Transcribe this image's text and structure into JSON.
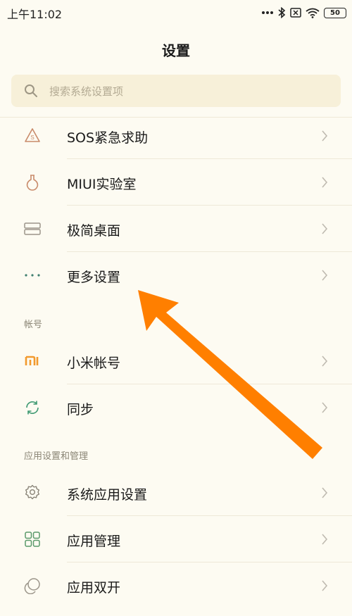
{
  "status_bar": {
    "time": "上午11:02",
    "battery": "50",
    "icons": [
      "dots-icon",
      "bluetooth-icon",
      "sim-off-icon",
      "wifi-icon",
      "battery-icon"
    ]
  },
  "page": {
    "title": "设置"
  },
  "search": {
    "placeholder": "搜索系统设置项"
  },
  "groups": [
    {
      "header": "",
      "items": [
        {
          "label": "SOS紧急求助",
          "icon": "sos-icon"
        },
        {
          "label": "MIUI实验室",
          "icon": "lab-flask-icon"
        },
        {
          "label": "极简桌面",
          "icon": "minimal-desktop-icon"
        },
        {
          "label": "更多设置",
          "icon": "more-dots-icon"
        }
      ]
    },
    {
      "header": "帐号",
      "items": [
        {
          "label": "小米帐号",
          "icon": "mi-logo-icon"
        },
        {
          "label": "同步",
          "icon": "sync-icon"
        }
      ]
    },
    {
      "header": "应用设置和管理",
      "items": [
        {
          "label": "系统应用设置",
          "icon": "gear-icon"
        },
        {
          "label": "应用管理",
          "icon": "apps-grid-icon"
        },
        {
          "label": "应用双开",
          "icon": "dual-apps-icon"
        }
      ]
    }
  ],
  "colors": {
    "background": "#fdfbf2",
    "search_background": "#f7f0d9",
    "annotation_arrow": "#ff7f00",
    "mi_orange": "#f29a2e",
    "sync_green": "#3f9a73"
  }
}
